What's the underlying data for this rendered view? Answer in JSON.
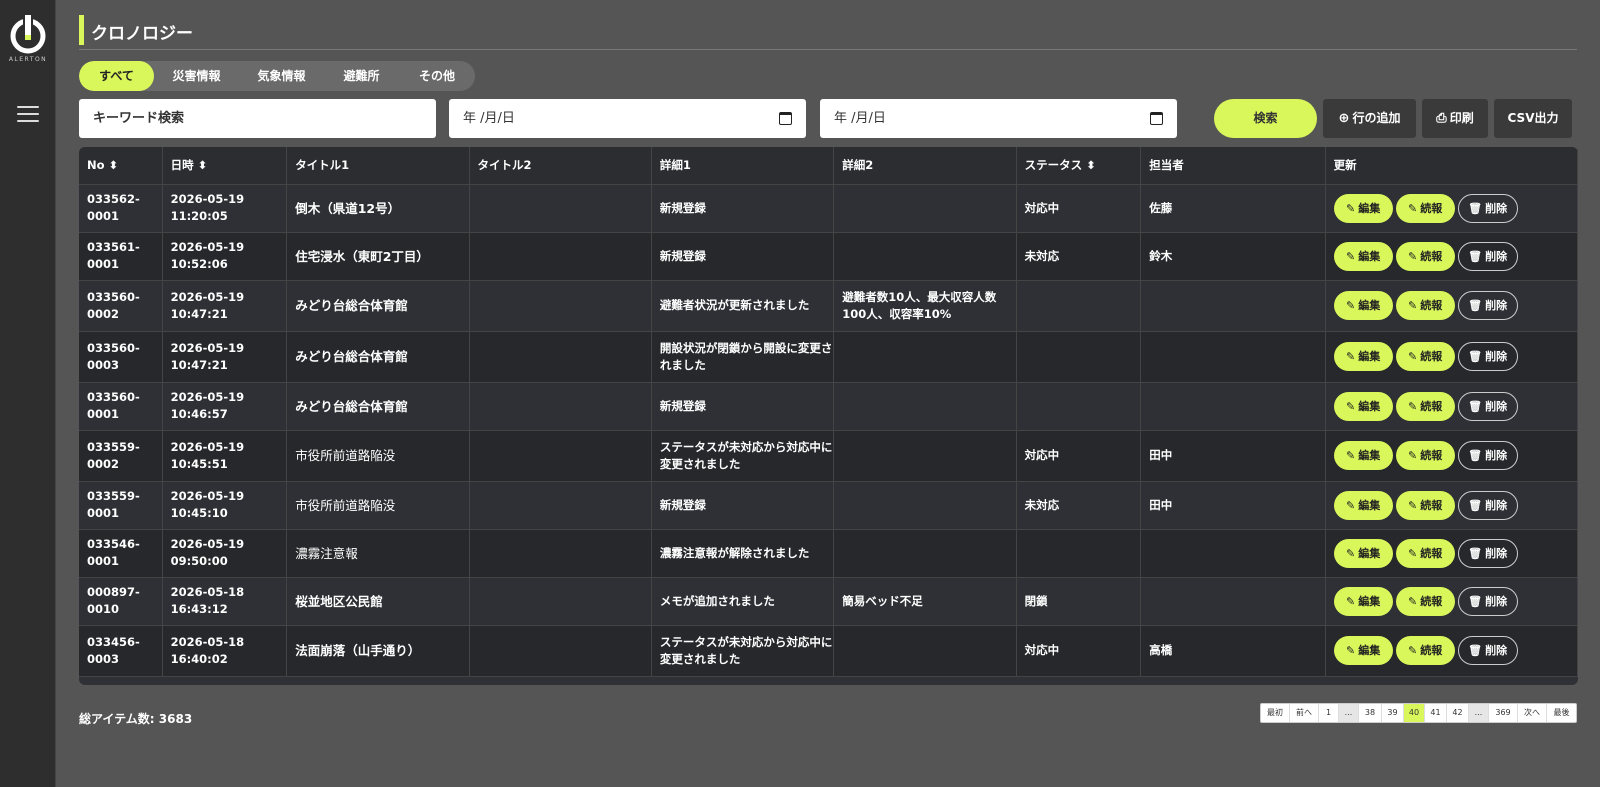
{
  "brand": {
    "name": "ALERTON",
    "accent": "#d9f75a"
  },
  "page": {
    "title": "クロノロジー"
  },
  "tabs": [
    {
      "label": "すべて",
      "active": true
    },
    {
      "label": "災害情報",
      "active": false
    },
    {
      "label": "気象情報",
      "active": false
    },
    {
      "label": "避難所",
      "active": false
    },
    {
      "label": "その他",
      "active": false
    }
  ],
  "search": {
    "keyword_placeholder": "キーワード検索",
    "date_from_placeholder": "年 /月/日",
    "date_to_placeholder": "年 /月/日",
    "search_label": "検索",
    "add_row_label": "行の追加",
    "print_label": "印刷",
    "csv_label": "CSV出力"
  },
  "table": {
    "headers": [
      "No ⬍",
      "日時 ⬍",
      "タイトル1",
      "タイトル2",
      "詳細1",
      "詳細2",
      "ステータス ⬍",
      "担当者",
      "更新"
    ],
    "action_labels": {
      "edit": "編集",
      "followup": "続報",
      "delete": "削除"
    },
    "rows": [
      {
        "no": "033562-0001",
        "datetime": "2026-05-19 11:20:05",
        "title1": "倒木（県道12号）",
        "title2": "",
        "detail1": "新規登録",
        "detail2": "",
        "status": "対応中",
        "assignee": "佐藤"
      },
      {
        "no": "033561-0001",
        "datetime": "2026-05-19 10:52:06",
        "title1": "住宅浸水（東町2丁目）",
        "title2": "",
        "detail1": "新規登録",
        "detail2": "",
        "status": "未対応",
        "assignee": "鈴木"
      },
      {
        "no": "033560-0002",
        "datetime": "2026-05-19 10:47:21",
        "title1": "みどり台総合体育館",
        "title2": "",
        "detail1": "避難者状況が更新されました",
        "detail2": "避難者数10人、最大収容人数100人、収容率10%",
        "status": "",
        "assignee": ""
      },
      {
        "no": "033560-0003",
        "datetime": "2026-05-19 10:47:21",
        "title1": "みどり台総合体育館",
        "title2": "",
        "detail1": "開設状況が閉鎖から開設に変更されました",
        "detail2": "",
        "status": "",
        "assignee": ""
      },
      {
        "no": "033560-0001",
        "datetime": "2026-05-19 10:46:57",
        "title1": "みどり台総合体育館",
        "title2": "",
        "detail1": "新規登録",
        "detail2": "",
        "status": "",
        "assignee": ""
      },
      {
        "no": "033559-0002",
        "datetime": "2026-05-19 10:45:51",
        "title1": "市役所前道路陥没",
        "title2": "",
        "detail1": "ステータスが未対応から対応中に変更されました",
        "detail2": "",
        "status": "対応中",
        "assignee": "田中"
      },
      {
        "no": "033559-0001",
        "datetime": "2026-05-19 10:45:10",
        "title1": "市役所前道路陥没",
        "title2": "",
        "detail1": "新規登録",
        "detail2": "",
        "status": "未対応",
        "assignee": "田中"
      },
      {
        "no": "033546-0001",
        "datetime": "2026-05-19 09:50:00",
        "title1": "濃霧注意報",
        "title2": "",
        "detail1": "濃霧注意報が解除されました",
        "detail2": "",
        "status": "",
        "assignee": ""
      },
      {
        "no": "000897-0010",
        "datetime": "2026-05-18 16:43:12",
        "title1": "桜並地区公民館",
        "title2": "",
        "detail1": "メモが追加されました",
        "detail2": "簡易ベッド不足",
        "status": "閉鎖",
        "assignee": ""
      },
      {
        "no": "033456-0003",
        "datetime": "2026-05-18 16:40:02",
        "title1": "法面崩落（山手通り）",
        "title2": "",
        "detail1": "ステータスが未対応から対応中に変更されました",
        "detail2": "",
        "status": "対応中",
        "assignee": "高橋"
      }
    ]
  },
  "footer": {
    "total_label": "総アイテム数: 3683",
    "pages": [
      "最初",
      "前へ",
      "1",
      "...",
      "38",
      "39",
      "40",
      "41",
      "42",
      "...",
      "369",
      "次へ",
      "最後"
    ],
    "current_page": "40"
  }
}
